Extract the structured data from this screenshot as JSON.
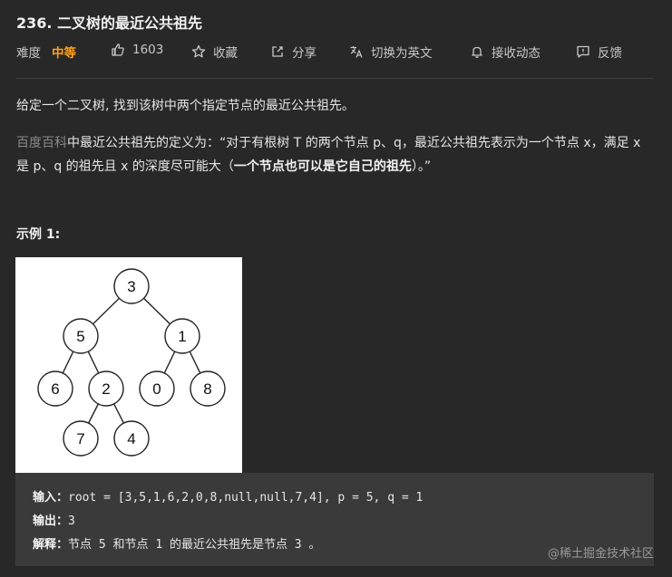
{
  "problem": {
    "title": "236. 二叉树的最近公共祖先"
  },
  "meta": {
    "difficulty_label": "难度",
    "difficulty": "中等",
    "likes": "1603",
    "collect": "收藏",
    "share": "分享",
    "switch_lang": "切换为英文",
    "notifications": "接收动态",
    "feedback": "反馈"
  },
  "description": {
    "intro": "给定一个二叉树, 找到该树中两个指定节点的最近公共祖先。",
    "link_text": "百度百科",
    "def_part1": "中最近公共祖先的定义为：“对于有根树 T 的两个节点 p、q，最近公共祖先表示为一个节点 x，满足 x 是 p、q 的祖先且 x 的深度尽可能大（",
    "def_bold": "一个节点也可以是它自己的祖先",
    "def_part2": "）。”"
  },
  "example": {
    "title": "示例 1:",
    "tree_nodes": [
      "3",
      "5",
      "1",
      "6",
      "2",
      "0",
      "8",
      "7",
      "4"
    ],
    "input_label": "输入：",
    "input_value": "root = [3,5,1,6,2,0,8,null,null,7,4], p = 5, q = 1",
    "output_label": "输出：",
    "output_value": "3",
    "explain_label": "解释：",
    "explain_value": "节点 5 和节点 1 的最近公共祖先是节点 3 。"
  },
  "watermark": "@稀土掘金技术社区"
}
